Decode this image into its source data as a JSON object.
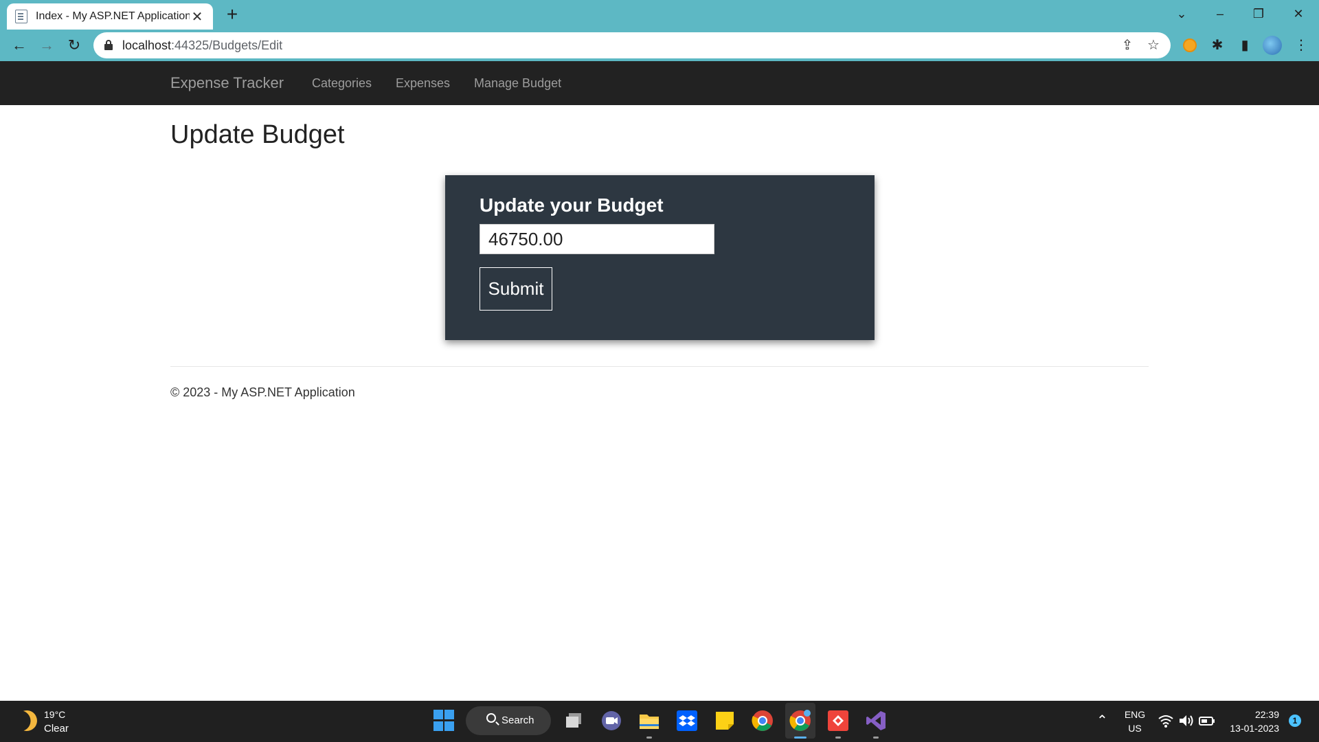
{
  "browser": {
    "tab_title": "Index - My ASP.NET Application",
    "tab_close": "✕",
    "new_tab": "+",
    "url_host": "localhost",
    "url_rest": ":44325/Budgets/Edit",
    "window_controls": {
      "tab_search": "⌄",
      "minimize": "–",
      "restore": "❐",
      "close": "✕"
    },
    "nav": {
      "back": "←",
      "forward": "→",
      "reload": "↻"
    },
    "toolbar_icons": {
      "share": "⇪",
      "bookmark": "☆",
      "extensions": "✱",
      "sidepanel": "▮",
      "menu": "⋮"
    }
  },
  "site": {
    "brand": "Expense Tracker",
    "nav_links": [
      "Categories",
      "Expenses",
      "Manage Budget"
    ],
    "page_title": "Update Budget",
    "form": {
      "heading": "Update your Budget",
      "budget_value": "46750.00",
      "submit_label": "Submit"
    },
    "footer": "© 2023 - My ASP.NET Application"
  },
  "taskbar": {
    "weather": {
      "temp": "19°C",
      "desc": "Clear"
    },
    "search_label": "Search",
    "tray": {
      "chevron": "⌃",
      "lang1": "ENG",
      "lang2": "US",
      "time": "22:39",
      "date": "13-01-2023",
      "notifications": "1"
    },
    "colors": {
      "accent": "#5ab0ee",
      "background": "#202020"
    }
  }
}
